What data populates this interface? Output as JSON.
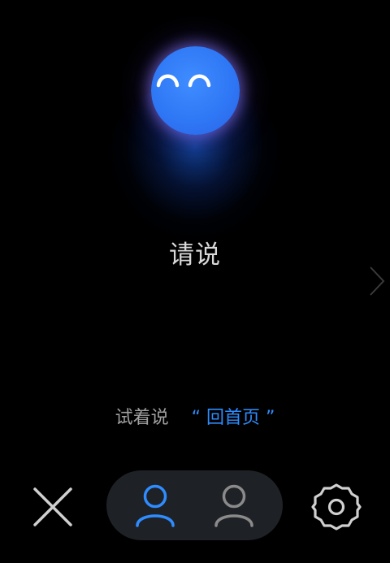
{
  "assistant": {
    "face_icon": "smiling-face-icon",
    "face_color": "#2f78f5"
  },
  "prompt": {
    "text": "请说"
  },
  "hint": {
    "prefix": "试着说",
    "open_quote": "“",
    "command": "回首页",
    "close_quote": "”"
  },
  "controls": {
    "close_icon": "close-icon",
    "mode_icons": [
      "user-icon",
      "user-icon"
    ],
    "active_mode_color": "#2f8cff",
    "inactive_mode_color": "#8a8a8a",
    "settings_icon": "gear-icon",
    "next_icon": "chevron-right-icon"
  }
}
